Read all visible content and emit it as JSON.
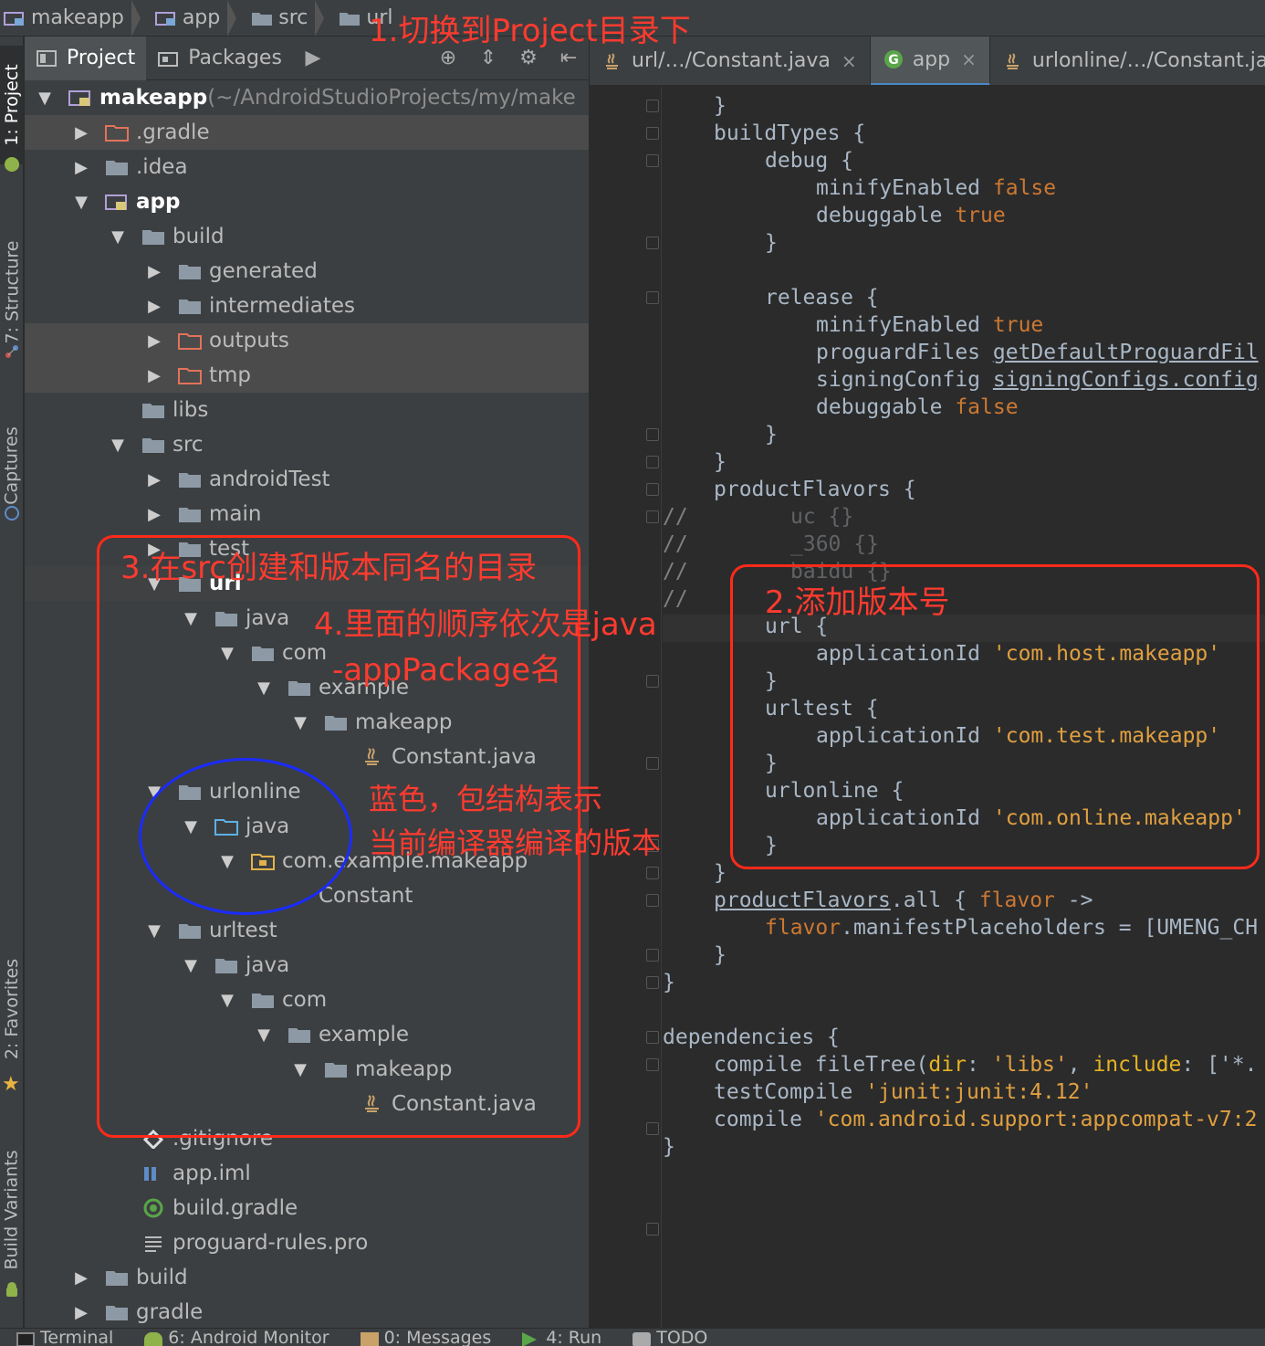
{
  "breadcrumb": [
    "makeapp",
    "app",
    "src",
    "url"
  ],
  "sidebar": {
    "project": "1: Project",
    "structure": "7: Structure",
    "captures": "Captures",
    "favorites": "2: Favorites",
    "build_variants": "Build Variants"
  },
  "project_toolbar": {
    "tab_project": "Project",
    "tab_packages": "Packages"
  },
  "tree": [
    {
      "label": "makeapp",
      "suffix": " (~/AndroidStudioProjects/my/make",
      "indent": 0,
      "arrow": "down",
      "icon": "module-folder"
    },
    {
      "label": ".gradle",
      "indent": 1,
      "arrow": "right",
      "icon": "excluded-folder"
    },
    {
      "label": ".idea",
      "indent": 1,
      "arrow": "right",
      "icon": "folder"
    },
    {
      "label": "app",
      "indent": 1,
      "arrow": "down",
      "icon": "module-folder"
    },
    {
      "label": "build",
      "indent": 2,
      "arrow": "down",
      "icon": "folder"
    },
    {
      "label": "generated",
      "indent": 3,
      "arrow": "right",
      "icon": "folder"
    },
    {
      "label": "intermediates",
      "indent": 3,
      "arrow": "right",
      "icon": "folder"
    },
    {
      "label": "outputs",
      "indent": 3,
      "arrow": "right",
      "icon": "excluded-folder"
    },
    {
      "label": "tmp",
      "indent": 3,
      "arrow": "right",
      "icon": "excluded-folder"
    },
    {
      "label": "libs",
      "indent": 2,
      "arrow": "",
      "icon": "folder"
    },
    {
      "label": "src",
      "indent": 2,
      "arrow": "down",
      "icon": "folder"
    },
    {
      "label": "androidTest",
      "indent": 3,
      "arrow": "right",
      "icon": "folder"
    },
    {
      "label": "main",
      "indent": 3,
      "arrow": "right",
      "icon": "folder"
    },
    {
      "label": "test",
      "indent": 3,
      "arrow": "right",
      "icon": "folder"
    },
    {
      "label": "url",
      "indent": 3,
      "arrow": "down",
      "icon": "folder"
    },
    {
      "label": "java",
      "indent": 4,
      "arrow": "down",
      "icon": "folder"
    },
    {
      "label": "com",
      "indent": 5,
      "arrow": "down",
      "icon": "folder"
    },
    {
      "label": "example",
      "indent": 6,
      "arrow": "down",
      "icon": "folder"
    },
    {
      "label": "makeapp",
      "indent": 7,
      "arrow": "down",
      "icon": "folder"
    },
    {
      "label": "Constant.java",
      "indent": 8,
      "arrow": "",
      "icon": "java-file"
    },
    {
      "label": "urlonline",
      "indent": 3,
      "arrow": "down",
      "icon": "folder"
    },
    {
      "label": "java",
      "indent": 4,
      "arrow": "down",
      "icon": "source-folder"
    },
    {
      "label": "com.example.makeapp",
      "indent": 5,
      "arrow": "down",
      "icon": "package"
    },
    {
      "label": "Constant",
      "indent": 6,
      "arrow": "",
      "icon": "class"
    },
    {
      "label": "urltest",
      "indent": 3,
      "arrow": "down",
      "icon": "folder"
    },
    {
      "label": "java",
      "indent": 4,
      "arrow": "down",
      "icon": "folder"
    },
    {
      "label": "com",
      "indent": 5,
      "arrow": "down",
      "icon": "folder"
    },
    {
      "label": "example",
      "indent": 6,
      "arrow": "down",
      "icon": "folder"
    },
    {
      "label": "makeapp",
      "indent": 7,
      "arrow": "down",
      "icon": "folder"
    },
    {
      "label": "Constant.java",
      "indent": 8,
      "arrow": "",
      "icon": "java-file"
    },
    {
      "label": ".gitignore",
      "indent": 2,
      "arrow": "",
      "icon": "git-file"
    },
    {
      "label": "app.iml",
      "indent": 2,
      "arrow": "",
      "icon": "iml-file"
    },
    {
      "label": "build.gradle",
      "indent": 2,
      "arrow": "",
      "icon": "gradle-file"
    },
    {
      "label": "proguard-rules.pro",
      "indent": 2,
      "arrow": "",
      "icon": "text-file"
    },
    {
      "label": "build",
      "indent": 1,
      "arrow": "right",
      "icon": "folder"
    },
    {
      "label": "gradle",
      "indent": 1,
      "arrow": "right",
      "icon": "folder"
    }
  ],
  "editor_tabs": [
    {
      "label": "url/…/Constant.java",
      "icon": "java-file",
      "close": "×"
    },
    {
      "label": "app",
      "icon": "gradle-file",
      "close": "×"
    },
    {
      "label": "urlonline/…/Constant.java",
      "icon": "java-file",
      "close": ""
    }
  ],
  "code": {
    "l0": "}",
    "build_types": "buildTypes {",
    "debug": "debug {",
    "minify_k": "minifyEnabled ",
    "false": "false",
    "debuggable_k": "debuggable ",
    "true": "true",
    "close": "}",
    "release": "release {",
    "proguard_k": "proguardFiles ",
    "proguard_v": "getDefaultProguardFil",
    "signing_k": "signingConfig ",
    "signing_v": "signingConfigs.config",
    "product_flavors": "productFlavors {",
    "c_slash": "//",
    "c_uc": "uc {}",
    "c_360": "_360 {}",
    "c_baidu": "baidu {}",
    "url_block": "url {",
    "appid_k": "applicationId ",
    "appid_url": "'com.host.makeapp'",
    "urltest_block": "urltest {",
    "appid_test": "'com.test.makeapp'",
    "urlonline_block": "urlonline {",
    "appid_online": "'com.online.makeapp'",
    "pf_all_a": "productFlavors",
    "pf_all_b": ".all { ",
    "flavor": "flavor",
    "arrow": " ->",
    "manifest_b": ".manifestPlaceholders = [UMENG_CH",
    "deps": "dependencies {",
    "compile_k": "compile ",
    "filetree": "fileTree(",
    "dir": "dir",
    "colon": ": ",
    "libs": "'libs'",
    "comma": ", ",
    "include": "include",
    "inc_v": ": ['*.",
    "test_compile_k": "testCompile ",
    "junit": "'junit:junit:4.12'",
    "appcompat": "'com.android.support:appcompat-v7:2"
  },
  "annotations": {
    "a1": "1.切换到Project目录下",
    "a2": "2.添加版本号",
    "a3": "3.在src创建和版本同名的目录",
    "a4_1": "4.里面的顺序依次是java",
    "a4_2": "-appPackage名",
    "blue_1": "蓝色，包结构表示",
    "blue_2": "当前编译器编译的版本"
  },
  "bottom_bar": [
    "Terminal",
    "6: Android Monitor",
    "0: Messages",
    "4: Run",
    "TODO"
  ],
  "colors": {
    "annotation_red": "#ff2a1a",
    "annotation_blue": "#1a2bff",
    "accent_tab": "#4a88c7"
  }
}
